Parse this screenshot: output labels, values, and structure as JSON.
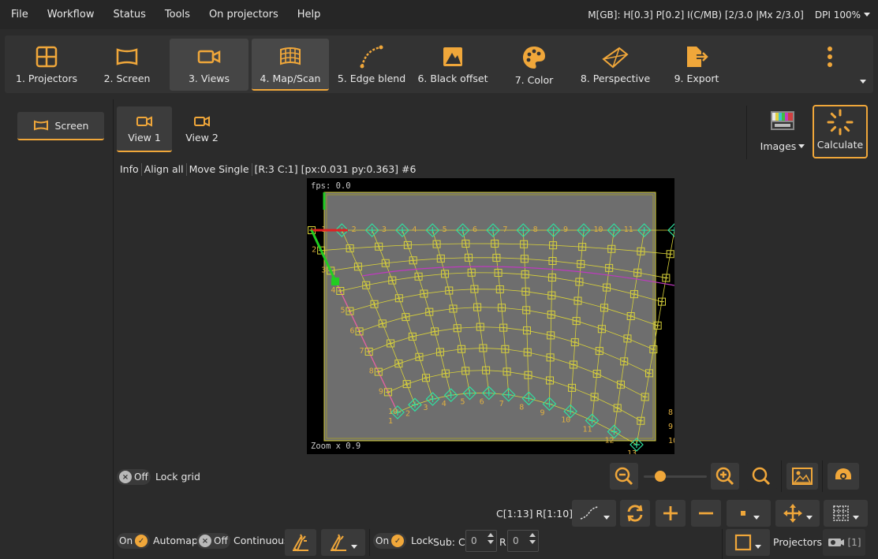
{
  "menu": {
    "items": [
      "File",
      "Workflow",
      "Status",
      "Tools",
      "On projectors",
      "Help"
    ],
    "status_text": "M[GB]: H[0.3] P[0.2] I(C/MB) [2/3.0 |Mx 2/3.0]",
    "dpi": "DPI 100%"
  },
  "toolbar": {
    "steps": [
      {
        "label": "1. Projectors",
        "icon": "projectors-grid-icon"
      },
      {
        "label": "2. Screen",
        "icon": "screen-icon"
      },
      {
        "label": "3. Views",
        "icon": "camera-icon"
      },
      {
        "label": "4. Map/Scan",
        "icon": "map-scan-icon"
      },
      {
        "label": "5. Edge blend",
        "icon": "edge-blend-icon"
      },
      {
        "label": "6. Black offset",
        "icon": "black-offset-icon"
      },
      {
        "label": "7. Color",
        "icon": "palette-icon"
      },
      {
        "label": "8. Perspective",
        "icon": "perspective-icon"
      },
      {
        "label": "9. Export",
        "icon": "export-icon"
      }
    ]
  },
  "left": {
    "screen_label": "Screen"
  },
  "views": {
    "tabs": [
      "View 1",
      "View 2"
    ]
  },
  "right": {
    "images_label": "Images",
    "calculate_label": "Calculate"
  },
  "infobar": {
    "info": "Info",
    "align_all": "Align all",
    "move_single": "Move Single",
    "position": "[R:3 C:1] [px:0.031 py:0.363] #6"
  },
  "viewport": {
    "fps": "fps: 0.0",
    "zoom": "Zoom x 0.9",
    "top_numbers": [
      "1",
      "2",
      "3",
      "4",
      "5",
      "6",
      "7",
      "8",
      "9",
      "10",
      "11"
    ],
    "left_numbers": [
      "1",
      "2",
      "3",
      "4",
      "5",
      "6",
      "7",
      "8",
      "9",
      "10"
    ],
    "bottom_numbers": [
      "1",
      "2",
      "3",
      "4",
      "5",
      "6",
      "7",
      "8",
      "9",
      "10",
      "11",
      "12",
      "13"
    ],
    "right_numbers": [
      "8",
      "9",
      "10"
    ],
    "colors": {
      "grid": "#d9d23a",
      "handle": "#2fe0a0",
      "grid_bg": "#6e6e6e",
      "magenta": "#c039c0",
      "red": "#e02020",
      "green": "#22cc22"
    }
  },
  "bottom": {
    "lock_grid_state": "Off",
    "lock_grid_label": "Lock grid",
    "grid_info": "C[1:13] R[1:10]",
    "automap_state": "On",
    "automap_label": "Automap",
    "continuous_state": "Off",
    "continuous_label": "Continuous",
    "lock_state": "On",
    "lock_label": "Lock",
    "sub_c_label": "Sub: C",
    "sub_c_value": "0",
    "r_label": "R",
    "r_value": "0",
    "projectors_label": "Projectors",
    "projector_count": "[1]"
  },
  "accent": "#f0a73a"
}
